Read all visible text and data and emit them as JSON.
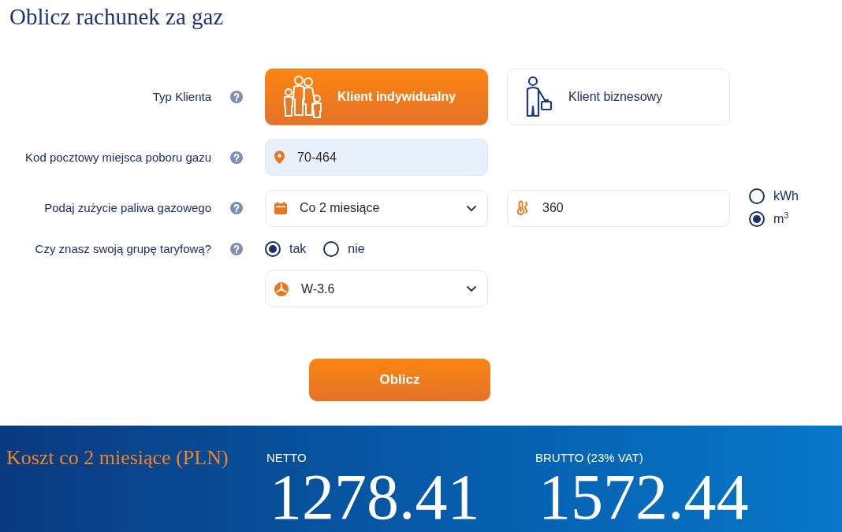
{
  "title": "Oblicz rachunek za gaz",
  "form": {
    "client_type": {
      "label": "Typ Klienta",
      "options": [
        {
          "kind": "individual",
          "label": "Klient indywidualny",
          "selected": true
        },
        {
          "kind": "business",
          "label": "Klient biznesowy",
          "selected": false
        }
      ]
    },
    "postal_code": {
      "label": "Kod pocztowy miejsca poboru gazu",
      "value": "70-464"
    },
    "consumption": {
      "label": "Podaj zużycie paliwa gazowego",
      "period": "Co 2 miesiące",
      "amount": "360",
      "units": [
        {
          "label": "kWh",
          "selected": false
        },
        {
          "label": "m$^{3}$",
          "selected": true
        }
      ]
    },
    "tariff_known": {
      "label": "Czy znasz swoją grupę taryfową?",
      "options": [
        {
          "label": "tak",
          "selected": true
        },
        {
          "label": "nie",
          "selected": false
        }
      ]
    },
    "tariff_group": {
      "value": "W-3.6"
    }
  },
  "submit_button": "Oblicz",
  "result": {
    "title": "Koszt co 2 miesiące (PLN)",
    "prices": [
      {
        "label": "NETTO",
        "value": "1278.41"
      },
      {
        "label": "BRUTTO (23% VAT)",
        "value": "1572.44"
      }
    ]
  }
}
